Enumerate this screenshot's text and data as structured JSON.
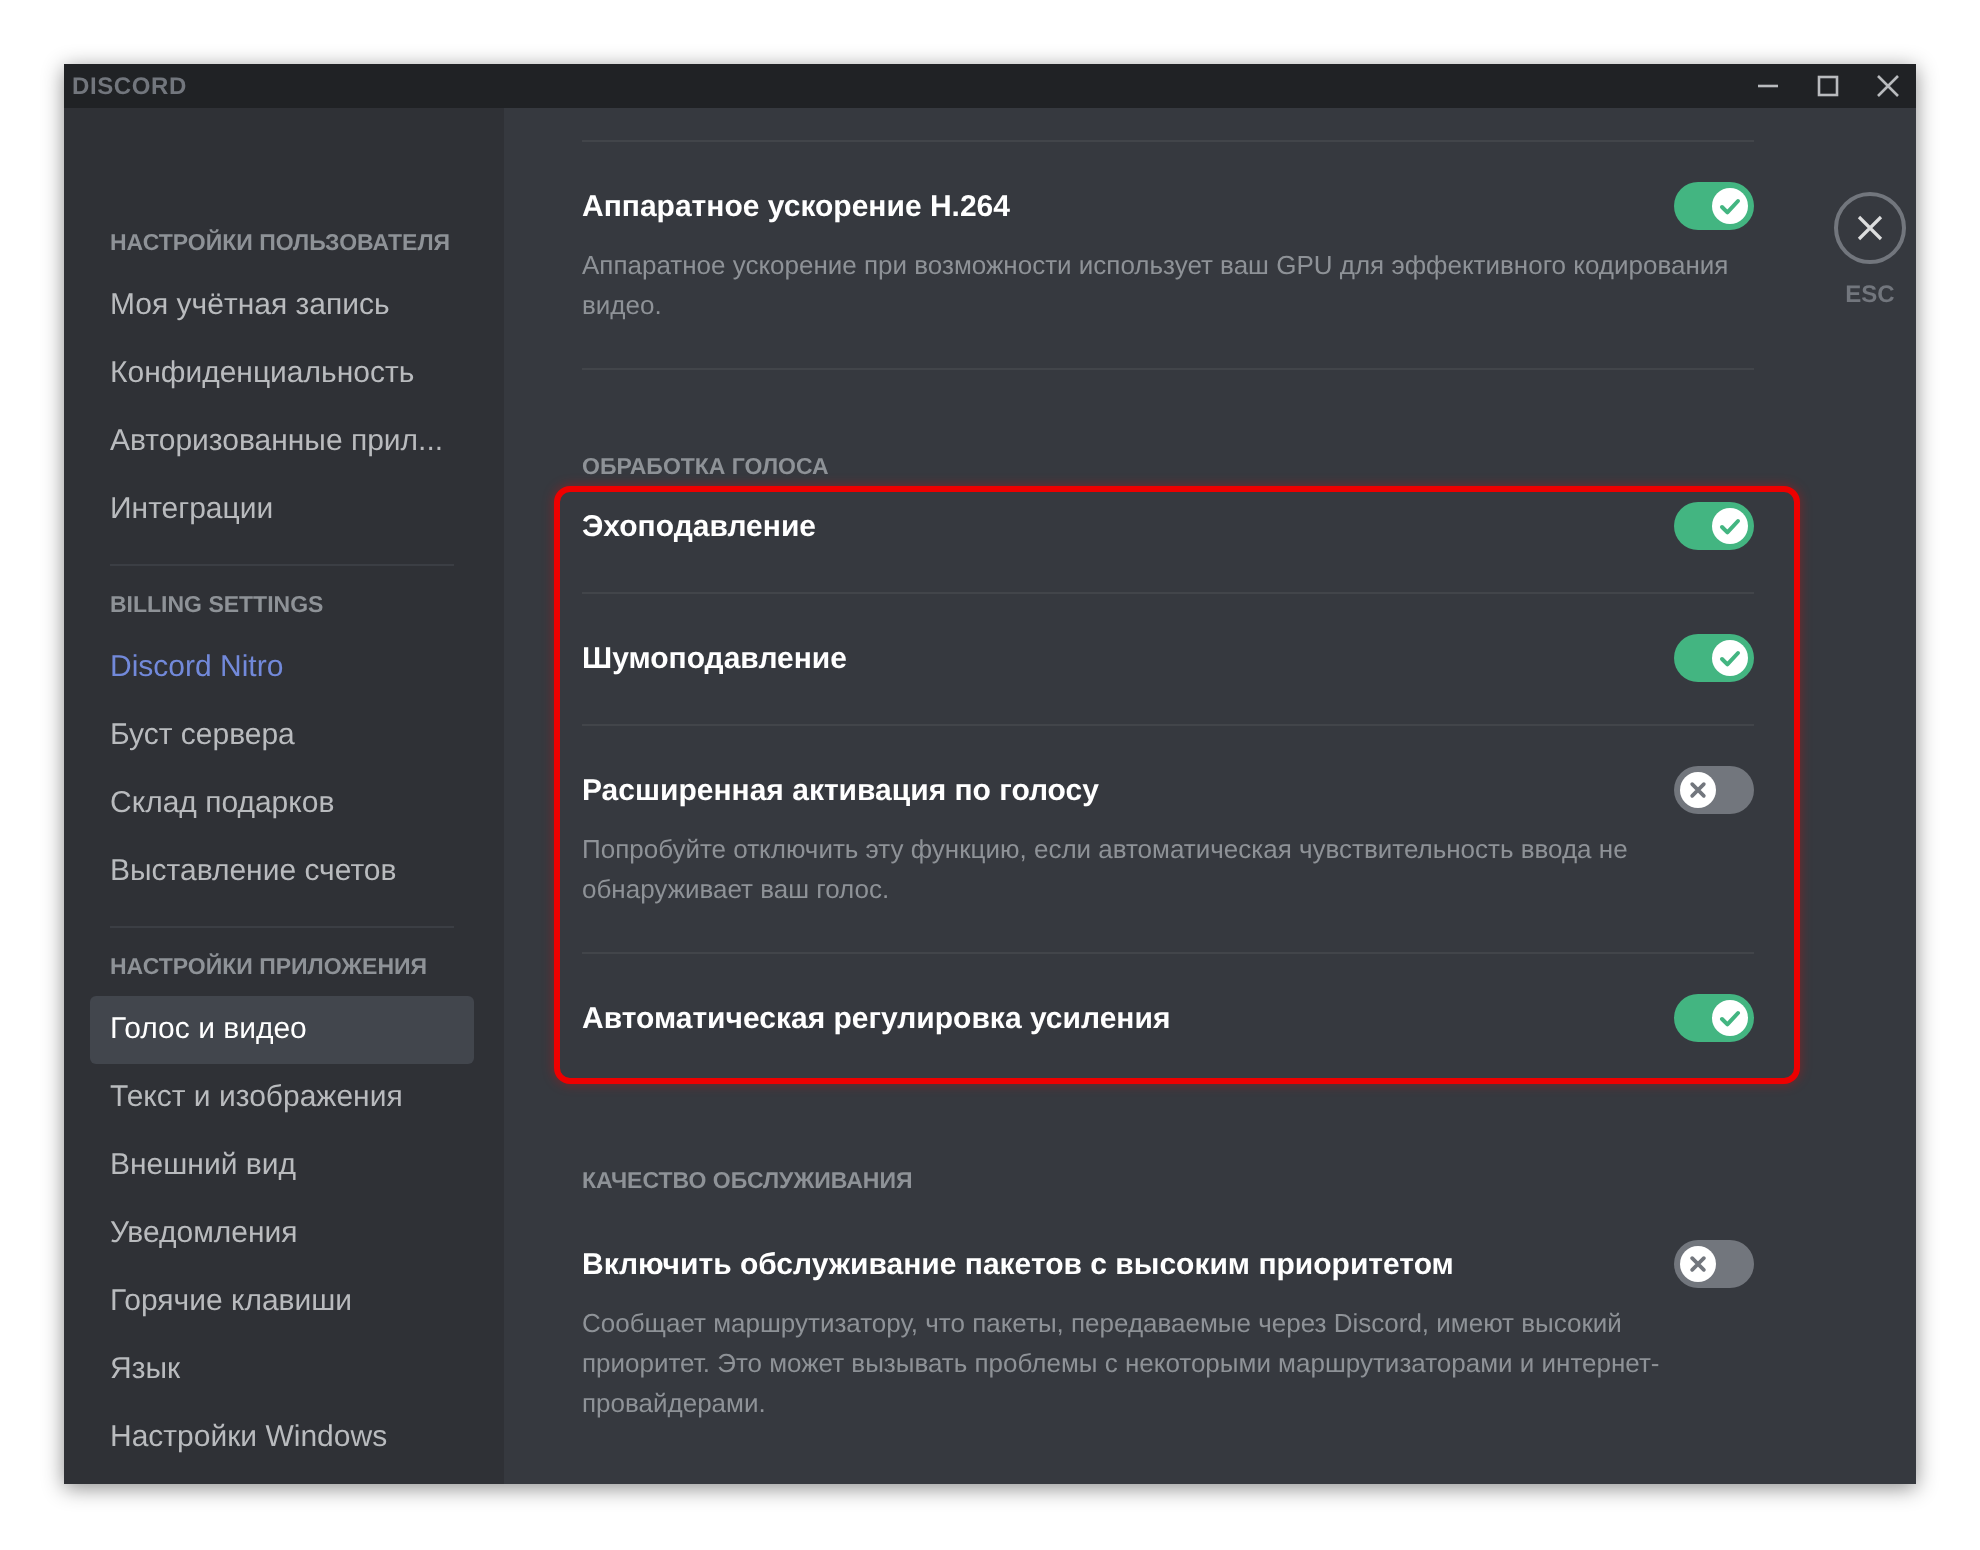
{
  "window": {
    "logo": "DISCORD"
  },
  "sidebar": {
    "groups": [
      {
        "header": "НАСТРОЙКИ ПОЛЬЗОВАТЕЛЯ",
        "items": [
          {
            "label": "Моя учётная запись",
            "selected": false,
            "kind": "normal"
          },
          {
            "label": "Конфиденциальность",
            "selected": false,
            "kind": "normal"
          },
          {
            "label": "Авторизованные прил...",
            "selected": false,
            "kind": "normal"
          },
          {
            "label": "Интеграции",
            "selected": false,
            "kind": "normal"
          }
        ]
      },
      {
        "header": "BILLING SETTINGS",
        "items": [
          {
            "label": "Discord Nitro",
            "selected": false,
            "kind": "accent"
          },
          {
            "label": "Буст сервера",
            "selected": false,
            "kind": "normal"
          },
          {
            "label": "Склад подарков",
            "selected": false,
            "kind": "normal"
          },
          {
            "label": "Выставление счетов",
            "selected": false,
            "kind": "normal"
          }
        ]
      },
      {
        "header": "НАСТРОЙКИ ПРИЛОЖЕНИЯ",
        "items": [
          {
            "label": "Голос и видео",
            "selected": true,
            "kind": "normal"
          },
          {
            "label": "Текст и изображения",
            "selected": false,
            "kind": "normal"
          },
          {
            "label": "Внешний вид",
            "selected": false,
            "kind": "normal"
          },
          {
            "label": "Уведомления",
            "selected": false,
            "kind": "normal"
          },
          {
            "label": "Горячие клавиши",
            "selected": false,
            "kind": "normal"
          },
          {
            "label": "Язык",
            "selected": false,
            "kind": "normal"
          },
          {
            "label": "Настройки Windows",
            "selected": false,
            "kind": "normal"
          }
        ]
      }
    ]
  },
  "close": {
    "label": "ESC"
  },
  "sections": [
    {
      "settings": [
        {
          "title": "Аппаратное ускорение H.264",
          "on": true,
          "description": "Аппаратное ускорение при возможности использует ваш GPU для эффективного кодирования видео."
        }
      ]
    },
    {
      "header": "ОБРАБОТКА ГОЛОСА",
      "highlighted": true,
      "settings": [
        {
          "title": "Эхоподавление",
          "on": true
        },
        {
          "title": "Шумоподавление",
          "on": true
        },
        {
          "title": "Расширенная активация по голосу",
          "on": false,
          "description": "Попробуйте отключить эту функцию, если автоматическая чувствительность ввода не обнаруживает ваш голос."
        },
        {
          "title": "Автоматическая регулировка усиления",
          "on": true
        }
      ]
    },
    {
      "header": "КАЧЕСТВО ОБСЛУЖИВАНИЯ",
      "settings": [
        {
          "title": "Включить обслуживание пакетов с высоким приоритетом",
          "on": false,
          "description": "Сообщает маршрутизатору, что пакеты, передаваемые через Discord, имеют высокий приоритет. Это может вызывать проблемы с некоторыми маршрутизаторами и интернет-провайдерами."
        }
      ]
    }
  ]
}
